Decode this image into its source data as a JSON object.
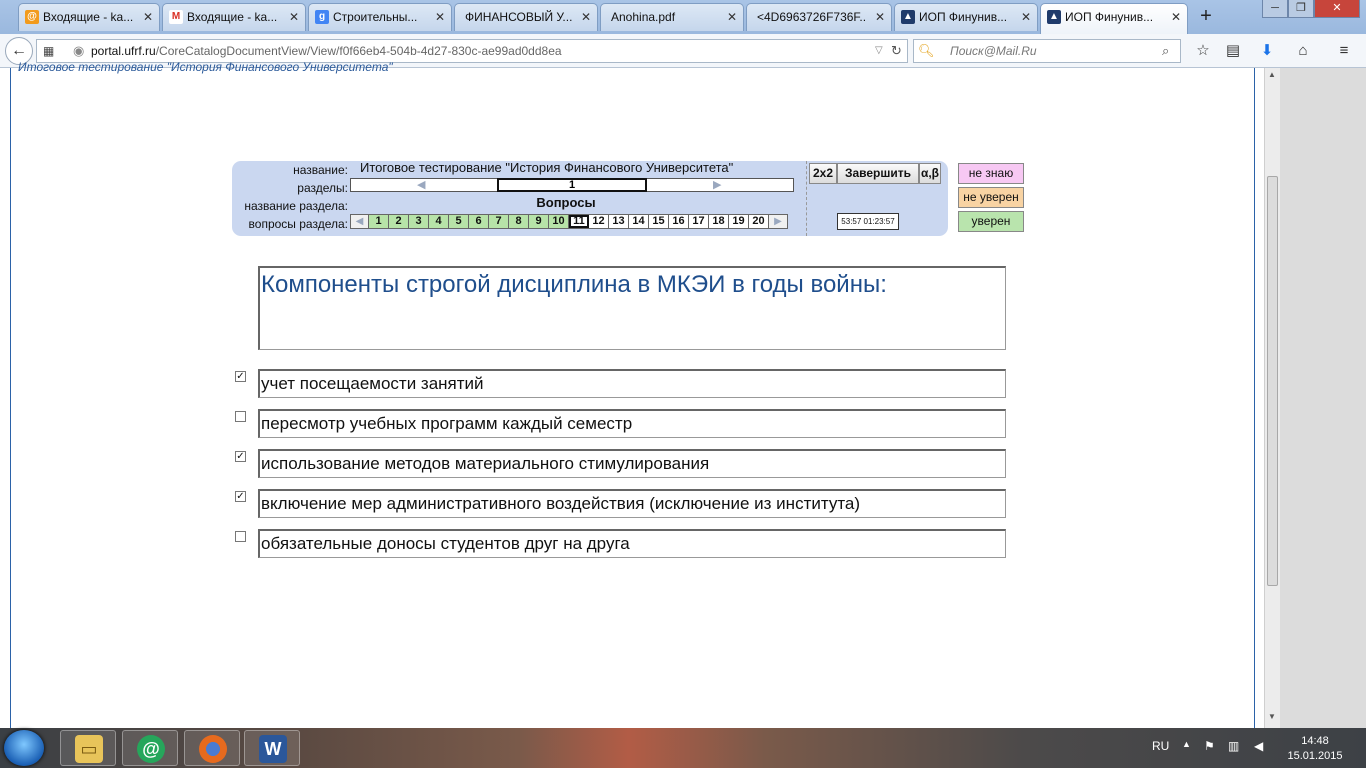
{
  "browser": {
    "tabs": [
      {
        "title": "Входящие - ka...",
        "icon": "mailru-icon",
        "color": "#f29b1d",
        "glyph": "@"
      },
      {
        "title": "Входящие - ka...",
        "icon": "gmail-icon",
        "color": "#d93025",
        "glyph": "M"
      },
      {
        "title": "Строительны...",
        "icon": "google-icon",
        "color": "#4285f4",
        "glyph": "g"
      },
      {
        "title": "ФИНАНСОВЫЙ У...",
        "icon": "none",
        "color": "",
        "glyph": ""
      },
      {
        "title": "Anohina.pdf",
        "icon": "none",
        "color": "",
        "glyph": ""
      },
      {
        "title": "<4D6963726F736F...",
        "icon": "none",
        "color": "",
        "glyph": ""
      },
      {
        "title": "ИОП Финунив...",
        "icon": "graduation-cap-icon",
        "color": "#1f3b6b",
        "glyph": "▲"
      },
      {
        "title": "ИОП Финунив...",
        "icon": "graduation-cap-icon",
        "color": "#1f3b6b",
        "glyph": "▲"
      }
    ],
    "url_host": "portal.ufrf.ru",
    "url_path": "/CoreCatalogDocumentView/View/f0f66eb4-504b-4d27-830c-ae99ad0dd8ea",
    "search_placeholder": "Поиск@Mail.Ru"
  },
  "page": {
    "cut_header": "Итоговое тестирование \"История Финансового Университета\"",
    "panel": {
      "label_name": "название:",
      "label_sections": "разделы:",
      "label_section_name": "название раздела:",
      "label_section_questions": "вопросы раздела:",
      "test_title": "Итоговое тестирование \"История Финансового Университета\"",
      "current_section": "1",
      "section_name": "Вопросы",
      "questions": [
        "1",
        "2",
        "3",
        "4",
        "5",
        "6",
        "7",
        "8",
        "9",
        "10",
        "11",
        "12",
        "13",
        "14",
        "15",
        "16",
        "17",
        "18",
        "19",
        "20"
      ],
      "answered_count": 10,
      "current_question": 11,
      "btn_2x2": "2x2",
      "btn_finish": "Завершить",
      "btn_alphabeta": "α,β",
      "timer": "53:57  01:23:57"
    },
    "confidence": {
      "dont_know": "не знаю",
      "not_sure": "не уверен",
      "sure": "уверен",
      "colors": {
        "dont_know": "#f7c8f3",
        "not_sure": "#f8d3a3",
        "sure": "#b9e4ad"
      }
    },
    "question": "Компоненты строгой  дисциплина в МКЭИ  в годы войны:",
    "answers": [
      {
        "text": "учет посещаемости занятий",
        "checked": true
      },
      {
        "text": "пересмотр учебных программ каждый семестр",
        "checked": false
      },
      {
        "text": "использование методов материального стимулирования",
        "checked": true
      },
      {
        "text": "включение мер административного воздействия (исключение из института)",
        "checked": true
      },
      {
        "text": "обязательные доносы студентов друг на друга",
        "checked": false
      }
    ]
  },
  "taskbar": {
    "lang": "RU",
    "time": "14:48",
    "date": "15.01.2015"
  }
}
